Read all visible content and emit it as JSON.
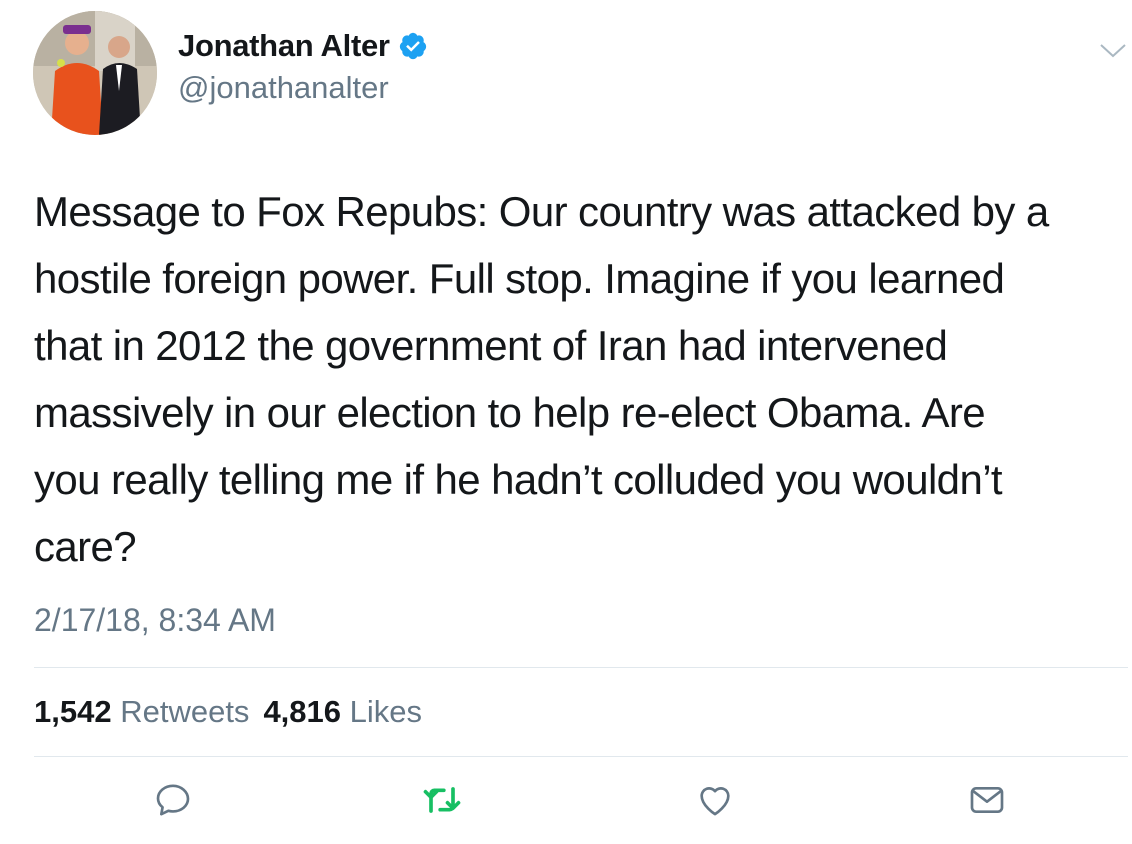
{
  "user": {
    "name": "Jonathan Alter",
    "handle": "@jonathanalter",
    "verified": true
  },
  "tweet": {
    "text": "Message to Fox Repubs: Our country was attacked by a\nhostile foreign power. Full stop. Imagine if you learned\nthat in 2012 the government of Iran had intervened\nmassively in our election to help re-elect Obama. Are\nyou really telling me if he hadn’t colluded you wouldn’t\ncare?",
    "timestamp": "2/17/18, 8:34 AM"
  },
  "stats": {
    "retweets_count": "1,542",
    "retweets_label": "Retweets",
    "likes_count": "4,816",
    "likes_label": "Likes"
  },
  "actions": [
    {
      "icon": "reply-icon"
    },
    {
      "icon": "retweet-icon"
    },
    {
      "icon": "heart-icon"
    },
    {
      "icon": "mail-icon"
    }
  ],
  "colors": {
    "text": "#14171a",
    "secondary": "#657786",
    "verified": "#1da1f2",
    "retweet_green": "#17bf63",
    "divider": "#e1e8ed"
  }
}
